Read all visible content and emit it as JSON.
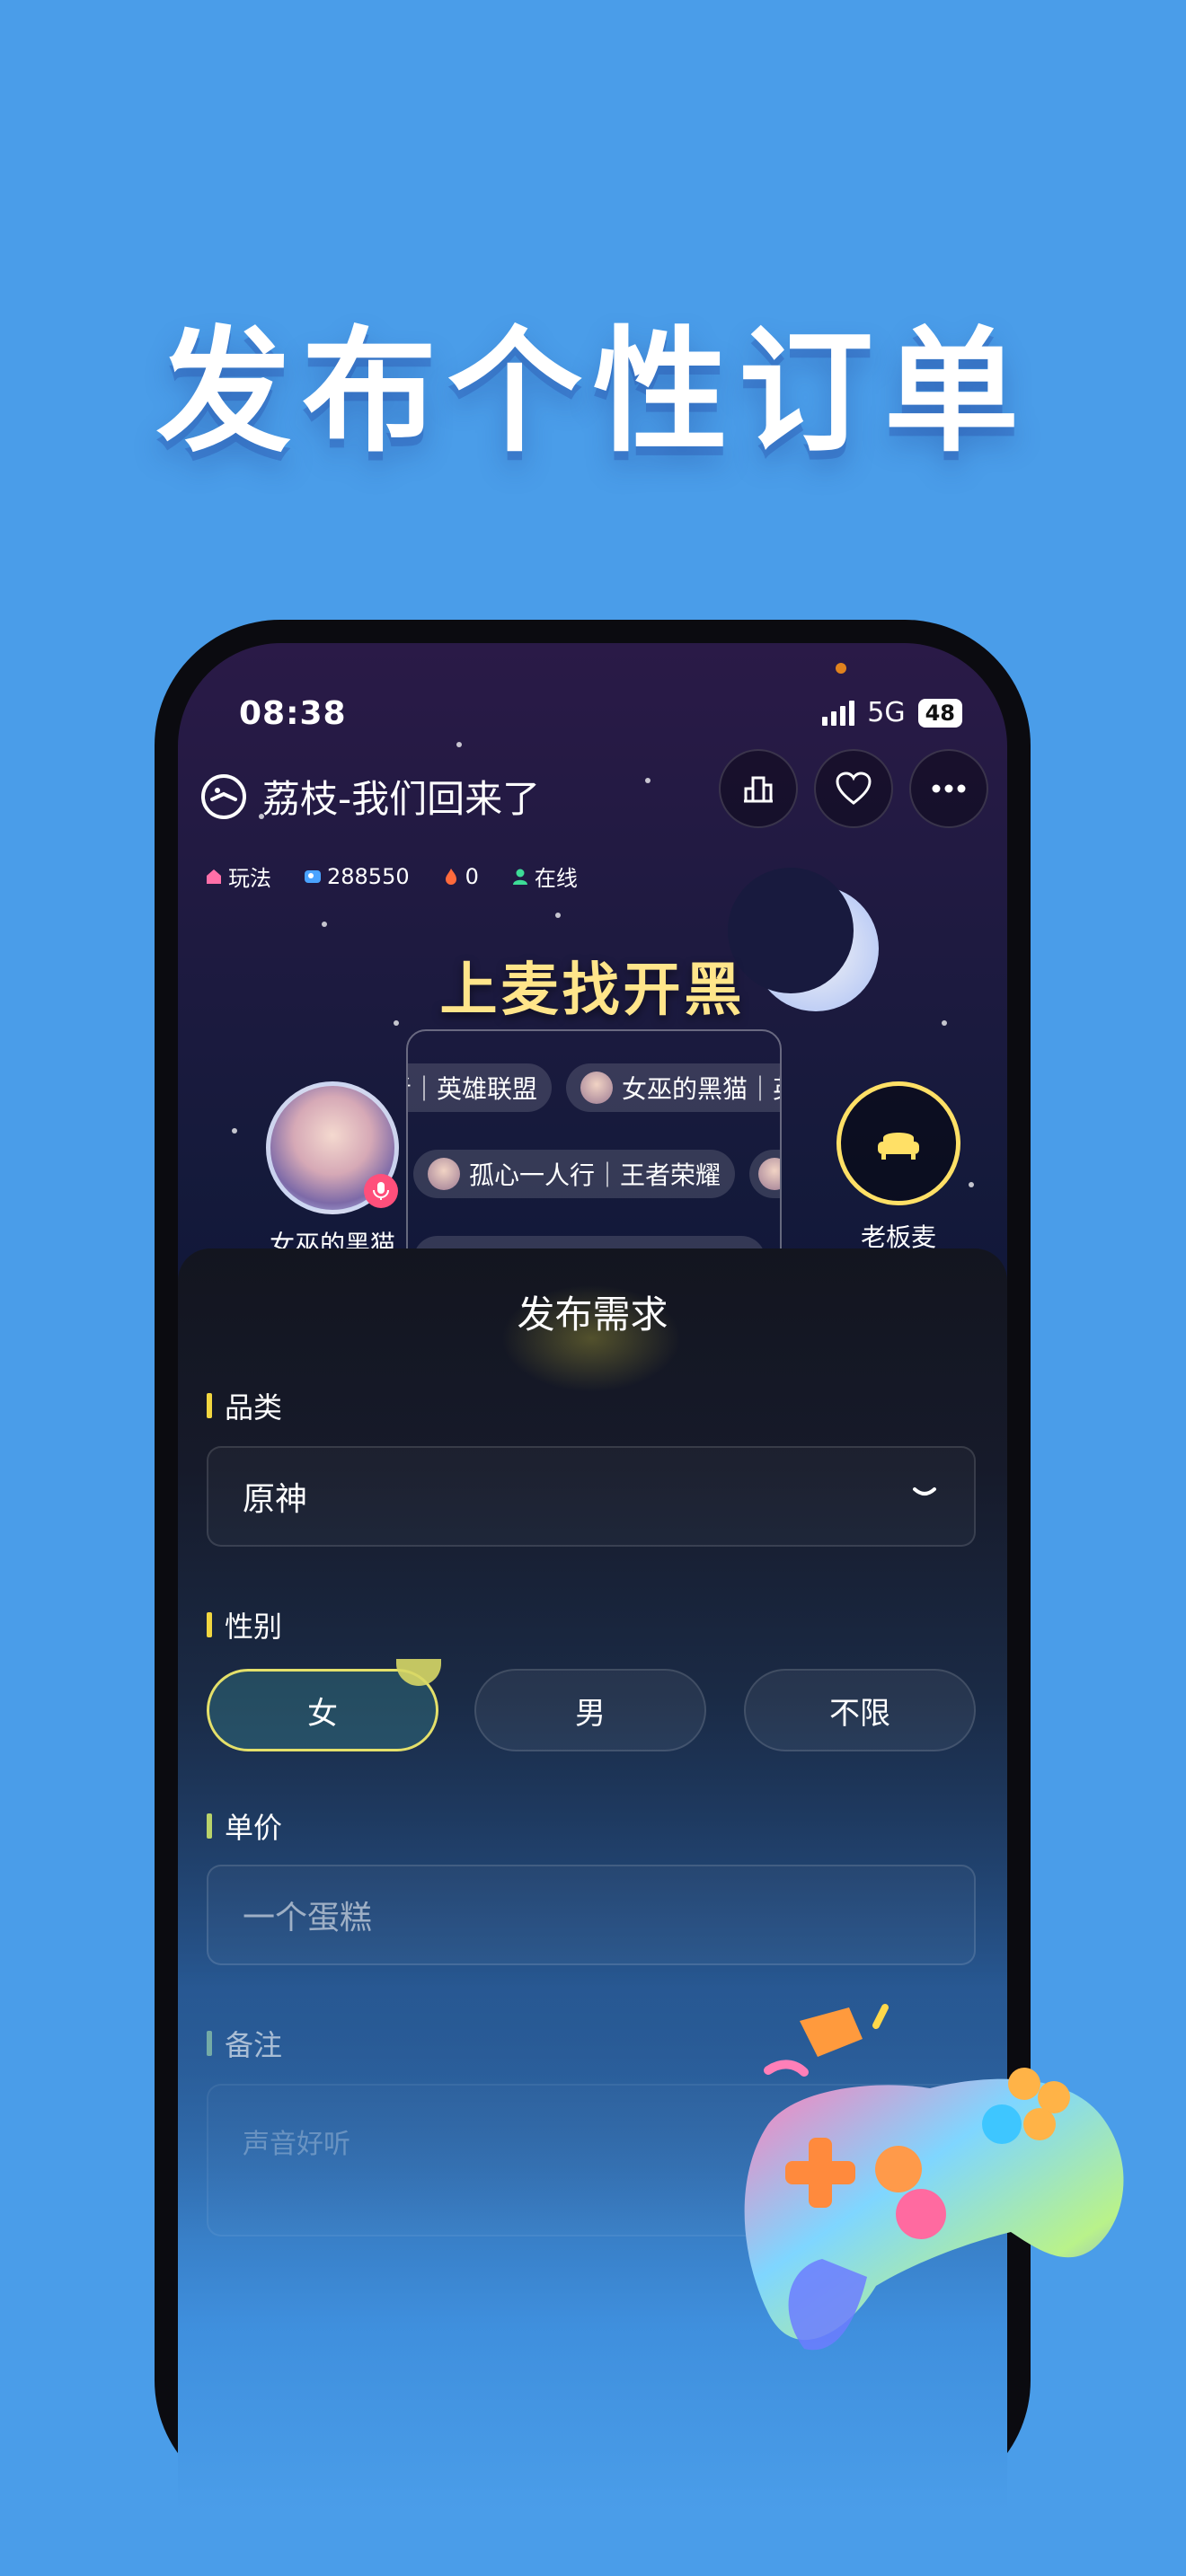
{
  "headline": "发布个性订单",
  "status_bar": {
    "time": "08:38",
    "network": "5G",
    "battery": "48"
  },
  "room": {
    "title": "荔枝-我们回来了",
    "stats": [
      {
        "icon": "house-icon",
        "label": "玩法"
      },
      {
        "icon": "users-icon",
        "label": "288550"
      },
      {
        "icon": "flame-icon",
        "label": "0"
      },
      {
        "icon": "person-icon",
        "label": "在线"
      }
    ],
    "banner_title": "上麦找开黑",
    "host_name": "女巫的黑猫",
    "boss_seat_label": "老板麦",
    "feed_chips": [
      "者｜英雄联盟",
      "女巫的黑猫｜英",
      "孤心一人行｜王者荣耀"
    ]
  },
  "sheet": {
    "title": "发布需求",
    "category": {
      "label": "品类",
      "value": "原神"
    },
    "gender": {
      "label": "性别",
      "options": [
        "女",
        "男",
        "不限"
      ],
      "selected": "女"
    },
    "price": {
      "label": "单价",
      "value": "一个蛋糕"
    },
    "note": {
      "label": "备注",
      "placeholder": "声音好听"
    }
  },
  "colors": {
    "background": "#4a9de9",
    "accent": "#f1d640",
    "badge": "#ff4f7b"
  }
}
